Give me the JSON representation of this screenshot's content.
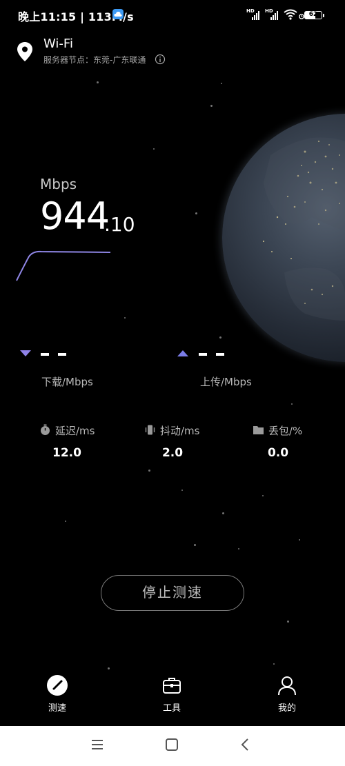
{
  "status_bar": {
    "time_text": "晚上11:15 | 113M/s",
    "hd_label": "HD",
    "battery_level": "62",
    "icons": [
      "cloud-icon",
      "signal-icon",
      "signal-icon",
      "wifi-icon",
      "alarm-icon",
      "battery-icon"
    ]
  },
  "header": {
    "network_name": "Wi-Fi",
    "server_node": "服务器节点：东莞-广东联通",
    "icons": [
      "location-icon",
      "info-icon"
    ]
  },
  "speed": {
    "unit": "Mbps",
    "value_int": "944",
    "value_dec": ".10",
    "current_speed_mbps": 944.1
  },
  "download": {
    "value": "– –",
    "label": "下载/Mbps"
  },
  "upload": {
    "value": "– –",
    "label": "上传/Mbps"
  },
  "stats": [
    {
      "label": "延迟/ms",
      "value": "12.0",
      "icon": "timer-icon"
    },
    {
      "label": "抖动/ms",
      "value": "2.0",
      "icon": "vibrate-icon"
    },
    {
      "label": "丢包/%",
      "value": "0.0",
      "icon": "folder-icon"
    }
  ],
  "stop_button": {
    "label": "停止测速"
  },
  "bottom_nav": [
    {
      "label": "测速",
      "icon": "speedometer-icon",
      "active": true
    },
    {
      "label": "工具",
      "icon": "toolbox-icon",
      "active": false
    },
    {
      "label": "我的",
      "icon": "user-icon",
      "active": false
    }
  ],
  "system_nav": [
    "menu-icon",
    "home-icon",
    "back-icon"
  ],
  "colors": {
    "background": "#000000",
    "accent_download": "#8f82e8",
    "accent_upload": "#7b7de8",
    "speed_line": "#8f86e6"
  }
}
